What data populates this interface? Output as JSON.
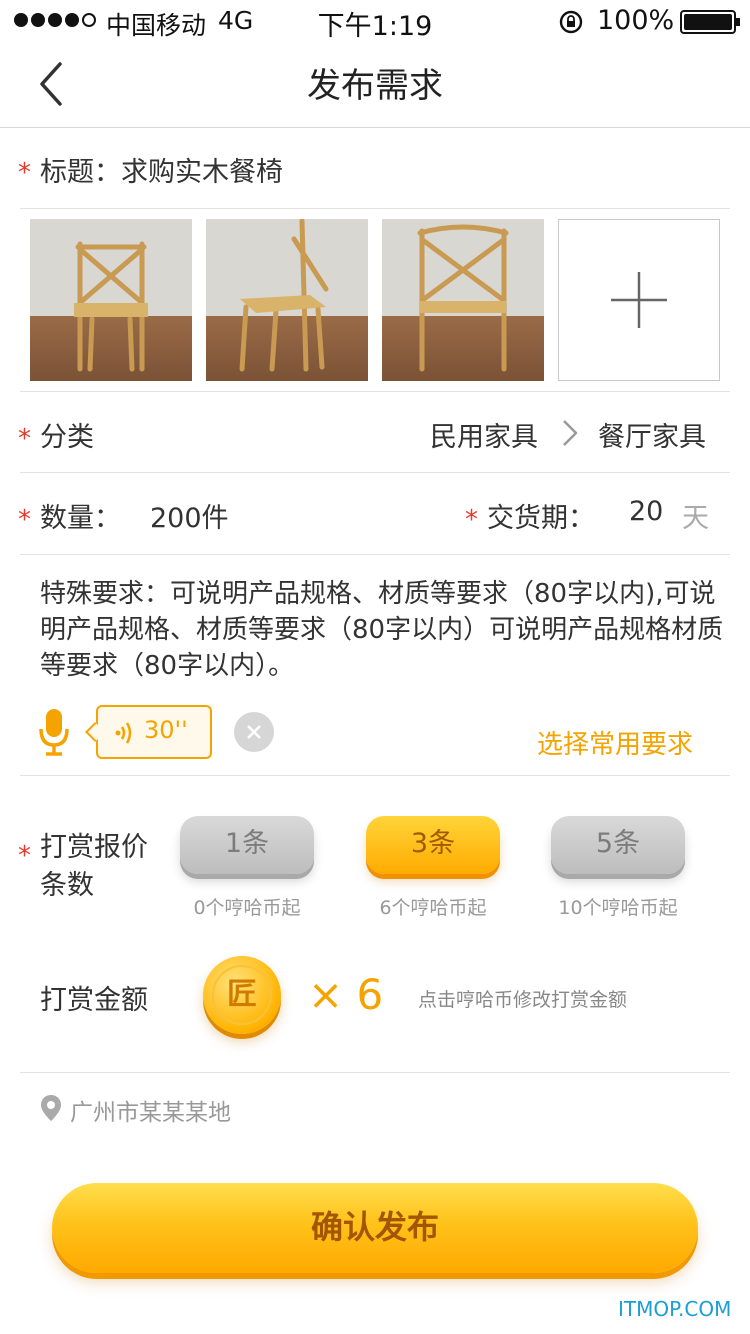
{
  "status_bar": {
    "carrier": "中国移动",
    "network": "4G",
    "time": "下午1:19",
    "battery": "100%"
  },
  "nav": {
    "title": "发布需求",
    "back_icon": "chevron-left-icon"
  },
  "form": {
    "title_label": "标题：",
    "title_value": "求购实木餐椅",
    "category_label": "分类",
    "category_primary": "民用家具",
    "category_secondary": "餐厅家具",
    "quantity_label": "数量：",
    "quantity_value": "200件",
    "delivery_label": "交货期：",
    "delivery_value": "20",
    "delivery_unit": "天",
    "special_text": "特殊要求：可说明产品规格、材质等要求（80字以内),可说明产品规格、材质等要求（80字以内）可说明产品规格材质等要求（80字以内）。",
    "voice_duration": "30''",
    "common_req_link": "选择常用要求",
    "reward_label_line1": "打赏报价",
    "reward_label_line2": "条数",
    "reward_options": [
      {
        "label": "1条",
        "sub": "0个哼哈币起",
        "selected": false
      },
      {
        "label": "3条",
        "sub": "6个哼哈币起",
        "selected": true
      },
      {
        "label": "5条",
        "sub": "10个哼哈币起",
        "selected": false
      }
    ],
    "amount_label": "打赏金额",
    "coin_char": "匠",
    "amount_multiplier": "× 6",
    "amount_hint": "点击哼哈币修改打赏金额",
    "location": "广州市某某某地"
  },
  "confirm_button": "确认发布",
  "watermark": "ITMOP.COM",
  "colors": {
    "accent": "#f5a300",
    "required": "#e23b2e",
    "gold": "#ffc21a"
  }
}
